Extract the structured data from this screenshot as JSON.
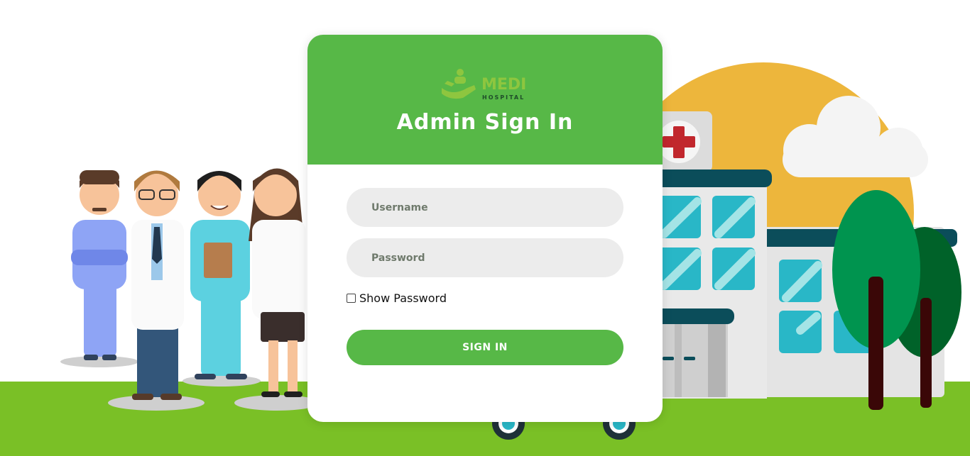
{
  "brand": {
    "logo_text": "MEDI",
    "logo_subtext": "HOSPITAL",
    "color": "#57b847"
  },
  "form": {
    "title": "Admin Sign In",
    "username_placeholder": "Username",
    "password_placeholder": "Password",
    "show_password_label": "Show Password",
    "show_password_checked": false,
    "submit_label": "SIGN IN"
  },
  "illustration": {
    "left_scene": "medical-staff-group",
    "right_scene": "hospital-building",
    "icons": [
      "red-cross-icon",
      "cloud-icon",
      "tree-icon",
      "sun-icon"
    ]
  }
}
